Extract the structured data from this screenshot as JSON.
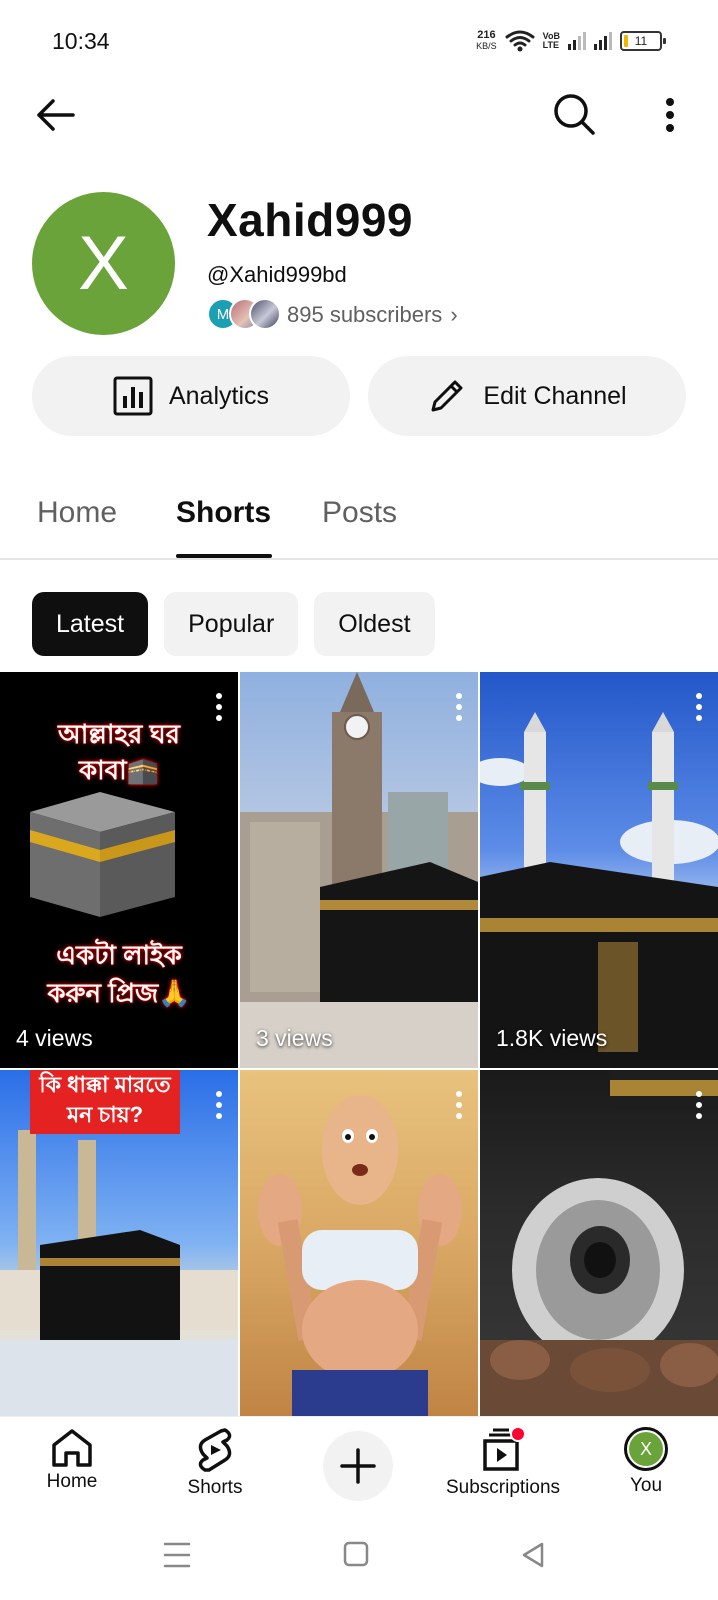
{
  "status_bar": {
    "time": "10:34",
    "net_speed": "216",
    "net_unit": "KB/S",
    "volte_top": "VoB",
    "volte_bottom": "LTE",
    "battery": "11"
  },
  "channel": {
    "avatar_letter": "X",
    "name": "Xahid999",
    "handle": "@Xahid999bd",
    "subscriber_avatar_letter": "M",
    "subscribers": "895 subscribers",
    "subscribers_chevron": "›",
    "avatar_color": "#6aa33a"
  },
  "actions": {
    "analytics_label": "Analytics",
    "edit_label": "Edit Channel"
  },
  "tabs": [
    {
      "label": "Home",
      "active": false
    },
    {
      "label": "Shorts",
      "active": true
    },
    {
      "label": "Posts",
      "active": false
    }
  ],
  "filters": [
    {
      "label": "Latest",
      "active": true
    },
    {
      "label": "Popular",
      "active": false
    },
    {
      "label": "Oldest",
      "active": false
    }
  ],
  "shorts": [
    {
      "views": "4 views",
      "overlay_top": "আল্লাহর ঘর\nকাবা🕋",
      "overlay_bottom": "একটা লাইক\nকরুন প্রিজ🙏"
    },
    {
      "views": "3 views"
    },
    {
      "views": "1.8K views"
    },
    {
      "views": "",
      "overlay_top": "কি ধাক্কা মারতে\nমন চায়?"
    },
    {
      "views": ""
    },
    {
      "views": ""
    }
  ],
  "bottom_nav": {
    "home": "Home",
    "shorts": "Shorts",
    "subscriptions": "Subscriptions",
    "you": "You",
    "you_avatar_letter": "X"
  },
  "icons": [
    "back-arrow-icon",
    "search-icon",
    "more-vert-icon",
    "analytics-icon",
    "pencil-icon",
    "home-icon",
    "shorts-icon",
    "plus-icon",
    "subscriptions-icon"
  ],
  "colors": {
    "accent": "#0f0f0f",
    "notification_dot": "#ff0033"
  }
}
